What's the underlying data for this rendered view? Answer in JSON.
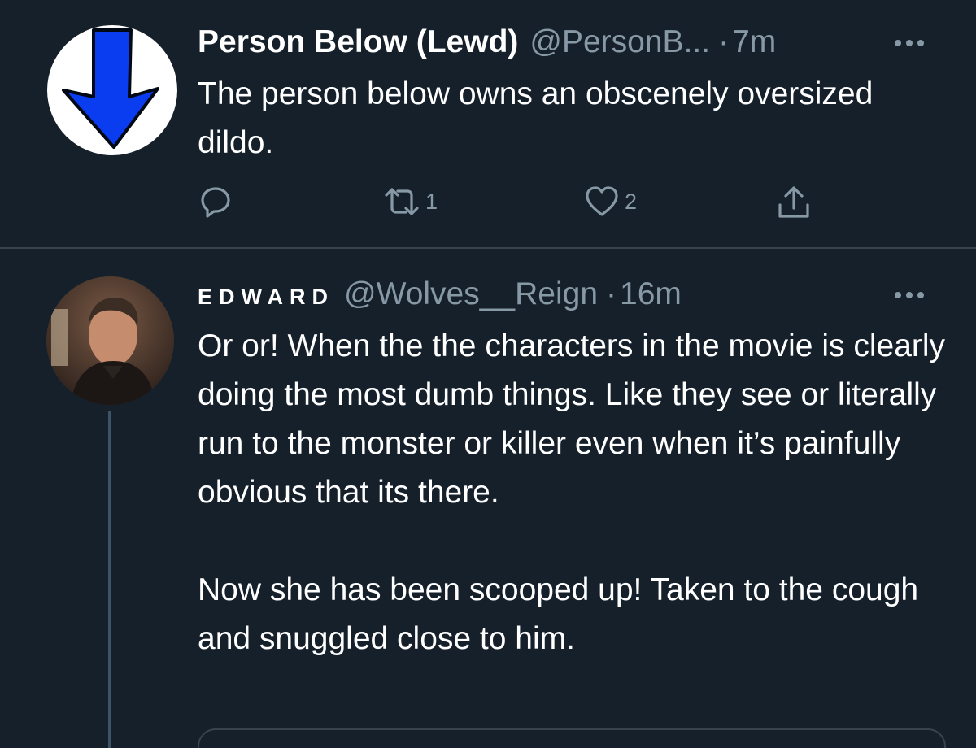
{
  "tweets": [
    {
      "avatar_icon": "down-arrow-icon",
      "display_name": "Person Below (Lewd)",
      "handle": "@PersonB...",
      "separator": "·",
      "time": "7m",
      "text": "The person below owns an obscenely oversized dildo.",
      "actions": {
        "reply_count": "",
        "retweet_count": "1",
        "like_count": "2"
      }
    },
    {
      "display_name": "EDWARD",
      "handle": "@Wolves__Reign",
      "separator": "·",
      "time": "16m",
      "paragraphs": [
        "Or or! When the the characters in the movie is clearly doing the most dumb things. Like they see or literally run to the monster or killer even when it’s painfully obvious that its there.",
        "Now she has been scooped up! Taken to the cough and snuggled close to him."
      ]
    }
  ],
  "colors": {
    "background": "#15202b",
    "divider": "#38444d",
    "secondary_text": "#8899a6",
    "arrow_blue": "#0a3cf0",
    "primary_text": "#ffffff"
  }
}
